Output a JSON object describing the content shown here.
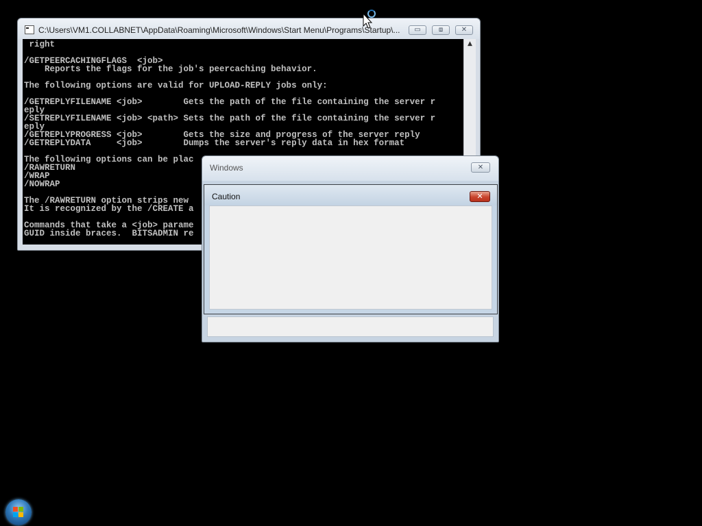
{
  "console": {
    "title": "C:\\Users\\VM1.COLLABNET\\AppData\\Roaming\\Microsoft\\Windows\\Start Menu\\Programs\\Startup\\...",
    "minimize_icon": "minimize-icon",
    "maximize_icon": "maximize-icon",
    "close_icon": "close-icon",
    "close_glyph": "✕",
    "minimize_glyph": "▭",
    "maximize_glyph": "⧈",
    "scroll_up_glyph": "▲",
    "lines": [
      " right",
      "",
      "/GETPEERCACHINGFLAGS  <job>",
      "    Reports the flags for the job's peercaching behavior.",
      "",
      "The following options are valid for UPLOAD-REPLY jobs only:",
      "",
      "/GETREPLYFILENAME <job>        Gets the path of the file containing the server r",
      "eply",
      "/SETREPLYFILENAME <job> <path> Sets the path of the file containing the server r",
      "eply",
      "/GETREPLYPROGRESS <job>        Gets the size and progress of the server reply",
      "/GETREPLYDATA     <job>        Dumps the server's reply data in hex format",
      "",
      "The following options can be plac",
      "/RAWRETURN                         Re",
      "/WRAP                              Wr",
      "/NOWRAP                            Do",
      "",
      "The /RAWRETURN option strips new",
      "It is recognized by the /CREATE a",
      "",
      "Commands that take a <job> parame",
      "GUID inside braces.  BITSADMIN re"
    ]
  },
  "windows_dialog": {
    "title": "Windows",
    "close_glyph": "✕"
  },
  "caution_dialog": {
    "title": "Caution",
    "close_glyph": "✕"
  },
  "start_orb_icon": "windows-logo-icon"
}
